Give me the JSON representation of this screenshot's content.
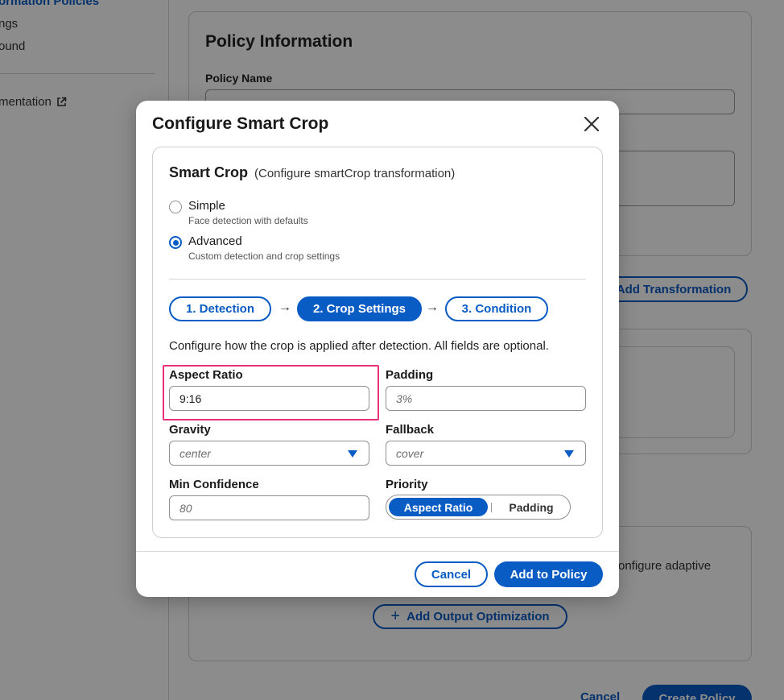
{
  "background": {
    "sidebar": {
      "items": [
        {
          "label": "ormation Policies",
          "active": true
        },
        {
          "label": "ngs"
        },
        {
          "label": "ound"
        },
        {
          "label": "mentation"
        }
      ]
    },
    "policy_card": {
      "title": "Policy Information",
      "policy_name_label": "Policy Name"
    },
    "add_transformation_label": "Add Transformation",
    "configure_adaptive_text": "onfigure adaptive",
    "add_output_optimization_label": "Add Output Optimization",
    "footer": {
      "cancel_label": "Cancel",
      "create_policy_label": "Create Policy"
    }
  },
  "modal": {
    "title": "Configure Smart Crop",
    "section_title": "Smart Crop",
    "section_subtitle": "(Configure smartCrop transformation)",
    "modes": [
      {
        "label": "Simple",
        "description": "Face detection with defaults",
        "selected": false
      },
      {
        "label": "Advanced",
        "description": "Custom detection and crop settings",
        "selected": true
      }
    ],
    "steps": [
      {
        "label": "1. Detection",
        "active": false
      },
      {
        "label": "2. Crop Settings",
        "active": true
      },
      {
        "label": "3. Condition",
        "active": false
      }
    ],
    "help_text": "Configure how the crop is applied after detection. All fields are optional.",
    "fields": {
      "aspect_ratio": {
        "label": "Aspect Ratio",
        "value": "9:16"
      },
      "padding": {
        "label": "Padding",
        "placeholder": "3%"
      },
      "gravity": {
        "label": "Gravity",
        "value": "center"
      },
      "fallback": {
        "label": "Fallback",
        "value": "cover"
      },
      "min_confidence": {
        "label": "Min Confidence",
        "placeholder": "80"
      },
      "priority": {
        "label": "Priority",
        "options": [
          "Aspect Ratio",
          "Padding"
        ],
        "selected": "Aspect Ratio"
      }
    },
    "cancel_label": "Cancel",
    "submit_label": "Add to Policy"
  },
  "colors": {
    "accent": "#0a5cc5",
    "highlight": "#e6317a"
  }
}
